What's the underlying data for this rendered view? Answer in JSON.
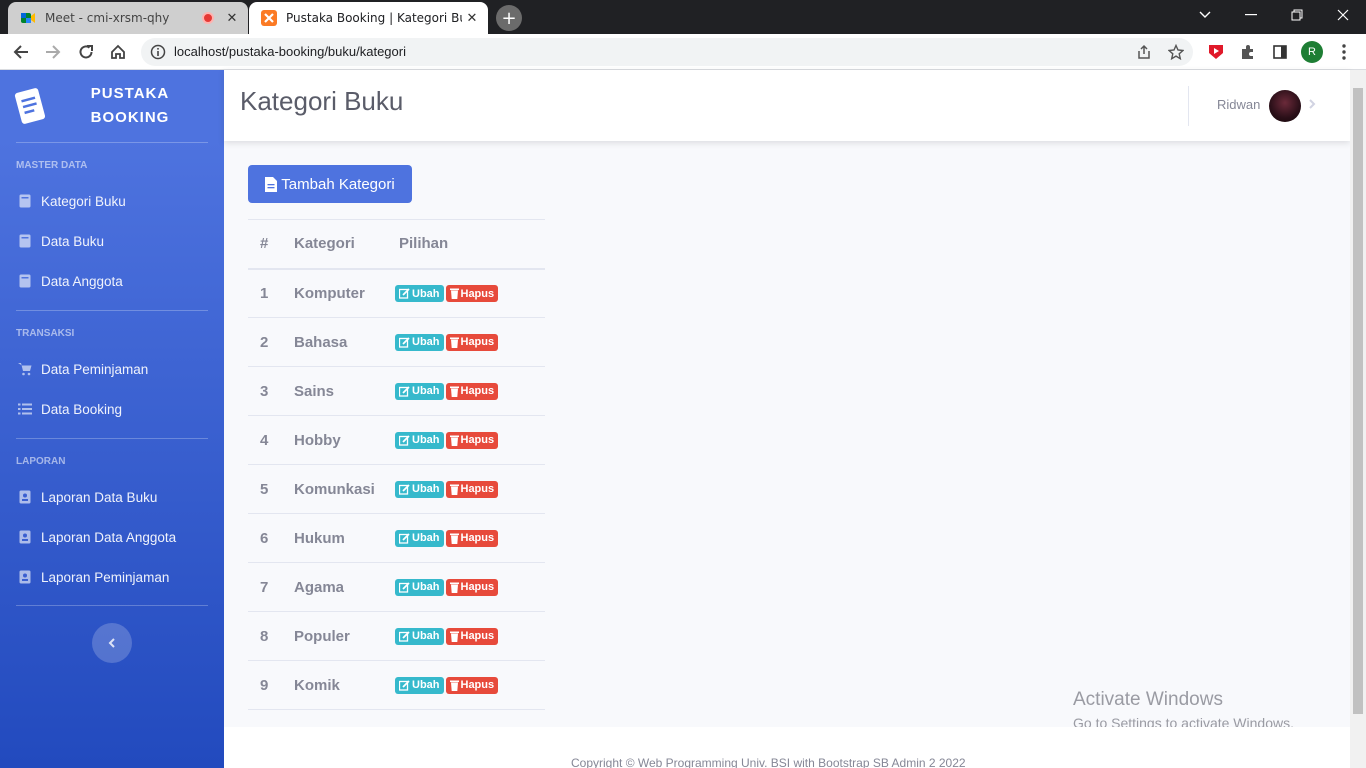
{
  "browser": {
    "tabs": [
      {
        "title": "Meet - cmi-xrsm-qhy",
        "active": false
      },
      {
        "title": "Pustaka Booking | Kategori Buku",
        "active": true
      }
    ],
    "url": "localhost/pustaka-booking/buku/kategori",
    "profile_initial": "R"
  },
  "sidebar": {
    "brand": {
      "line1": "PUSTAKA",
      "line2": "BOOKING"
    },
    "sections": [
      {
        "heading": "MASTER DATA",
        "items": [
          "Kategori Buku",
          "Data Buku",
          "Data Anggota"
        ]
      },
      {
        "heading": "TRANSAKSI",
        "items": [
          "Data Peminjaman",
          "Data Booking"
        ]
      },
      {
        "heading": "LAPORAN",
        "items": [
          "Laporan Data Buku",
          "Laporan Data Anggota",
          "Laporan Peminjaman"
        ]
      }
    ]
  },
  "topbar": {
    "title": "Kategori Buku",
    "user": "Ridwan"
  },
  "main": {
    "add_button": "Tambah Kategori",
    "table": {
      "headers": [
        "#",
        "Kategori",
        "Pilihan"
      ],
      "edit_label": "Ubah",
      "delete_label": "Hapus",
      "rows": [
        {
          "no": "1",
          "kategori": "Komputer"
        },
        {
          "no": "2",
          "kategori": "Bahasa"
        },
        {
          "no": "3",
          "kategori": "Sains"
        },
        {
          "no": "4",
          "kategori": "Hobby"
        },
        {
          "no": "5",
          "kategori": "Komunkasi"
        },
        {
          "no": "6",
          "kategori": "Hukum"
        },
        {
          "no": "7",
          "kategori": "Agama"
        },
        {
          "no": "8",
          "kategori": "Populer"
        },
        {
          "no": "9",
          "kategori": "Komik"
        }
      ]
    }
  },
  "watermark": {
    "line1": "Activate Windows",
    "line2": "Go to Settings to activate Windows."
  },
  "footer": {
    "copyright": "Copyright © Web Programming Univ. BSI with Bootstrap SB Admin 2 2022"
  },
  "colors": {
    "primary": "#4e73df",
    "info": "#36b9cc",
    "danger": "#e74a3b"
  }
}
